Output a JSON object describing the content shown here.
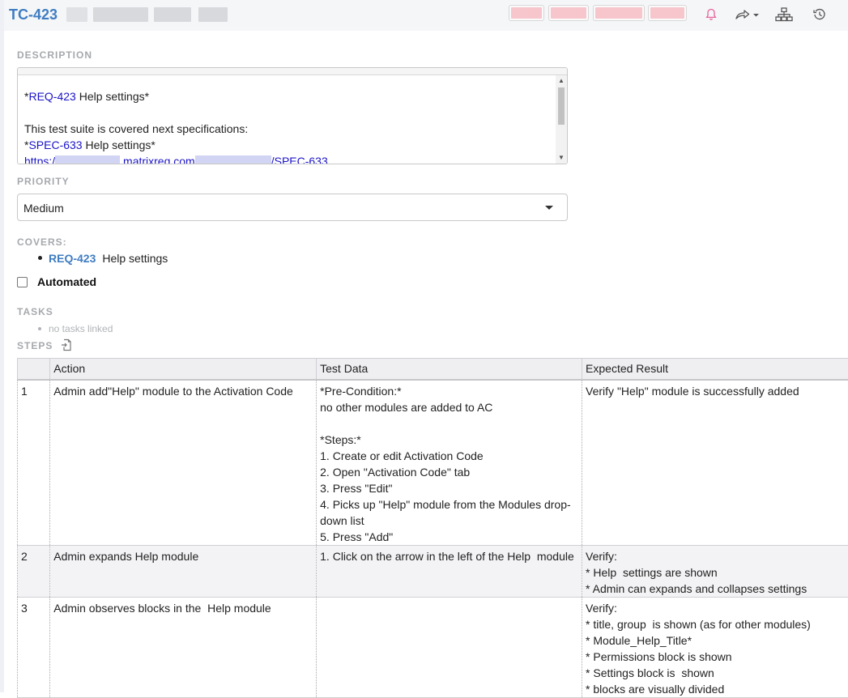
{
  "header": {
    "item_id": "TC-423"
  },
  "description": {
    "label": "DESCRIPTION",
    "line1_prefix": "*",
    "line1_link": "REQ-423",
    "line1_suffix": " Help settings*",
    "line2": "This test suite is covered next specifications:",
    "line3_prefix": "*",
    "line3_link": "SPEC-633",
    "line3_suffix": " Help settings*",
    "line4_start": "https:/",
    "line4_mid": ".matrixreq.com",
    "line4_end": "/SPEC-633"
  },
  "priority": {
    "label": "PRIORITY",
    "value": "Medium"
  },
  "covers": {
    "label": "COVERS:",
    "items": [
      {
        "id": "REQ-423",
        "title": "Help settings"
      }
    ]
  },
  "automated": {
    "label": "Automated",
    "checked": false
  },
  "tasks": {
    "label": "TASKS",
    "empty_text": "no tasks linked"
  },
  "steps": {
    "label": "STEPS",
    "columns": [
      "",
      "Action",
      "Test Data",
      "Expected Result"
    ],
    "rows": [
      {
        "num": "1",
        "action": "Admin add\"Help\" module to the Activation Code",
        "data": "*Pre-Condition:*\nno other modules are added to AC\n\n*Steps:*\n1. Create or edit Activation Code\n2. Open \"Activation Code\" tab\n3. Press \"Edit\"\n4. Picks up \"Help\" module from the Modules drop-down list\n5. Press \"Add\"",
        "expected": "Verify \"Help\" module is successfully added"
      },
      {
        "num": "2",
        "action": "Admin expands Help module",
        "data": "1. Click on the arrow in the left of the Help  module",
        "expected": "Verify:\n* Help  settings are shown\n* Admin can expands and collapses settings"
      },
      {
        "num": "3",
        "action": "Admin observes blocks in the  Help module",
        "data": "",
        "expected": "Verify:\n* title, group  is shown (as for other modules)\n* Module_Help_Title*\n* Permissions block is shown\n* Settings block is  shown\n* blocks are visually divided"
      }
    ]
  },
  "colors": {
    "link": "#3f7dc2",
    "desc_link": "#1b14c7",
    "label": "#a6a9ad",
    "notify_icon": "#e8609a"
  },
  "icons": [
    "bell-icon",
    "share-icon",
    "hierarchy-icon",
    "history-icon",
    "add-file-icon"
  ]
}
